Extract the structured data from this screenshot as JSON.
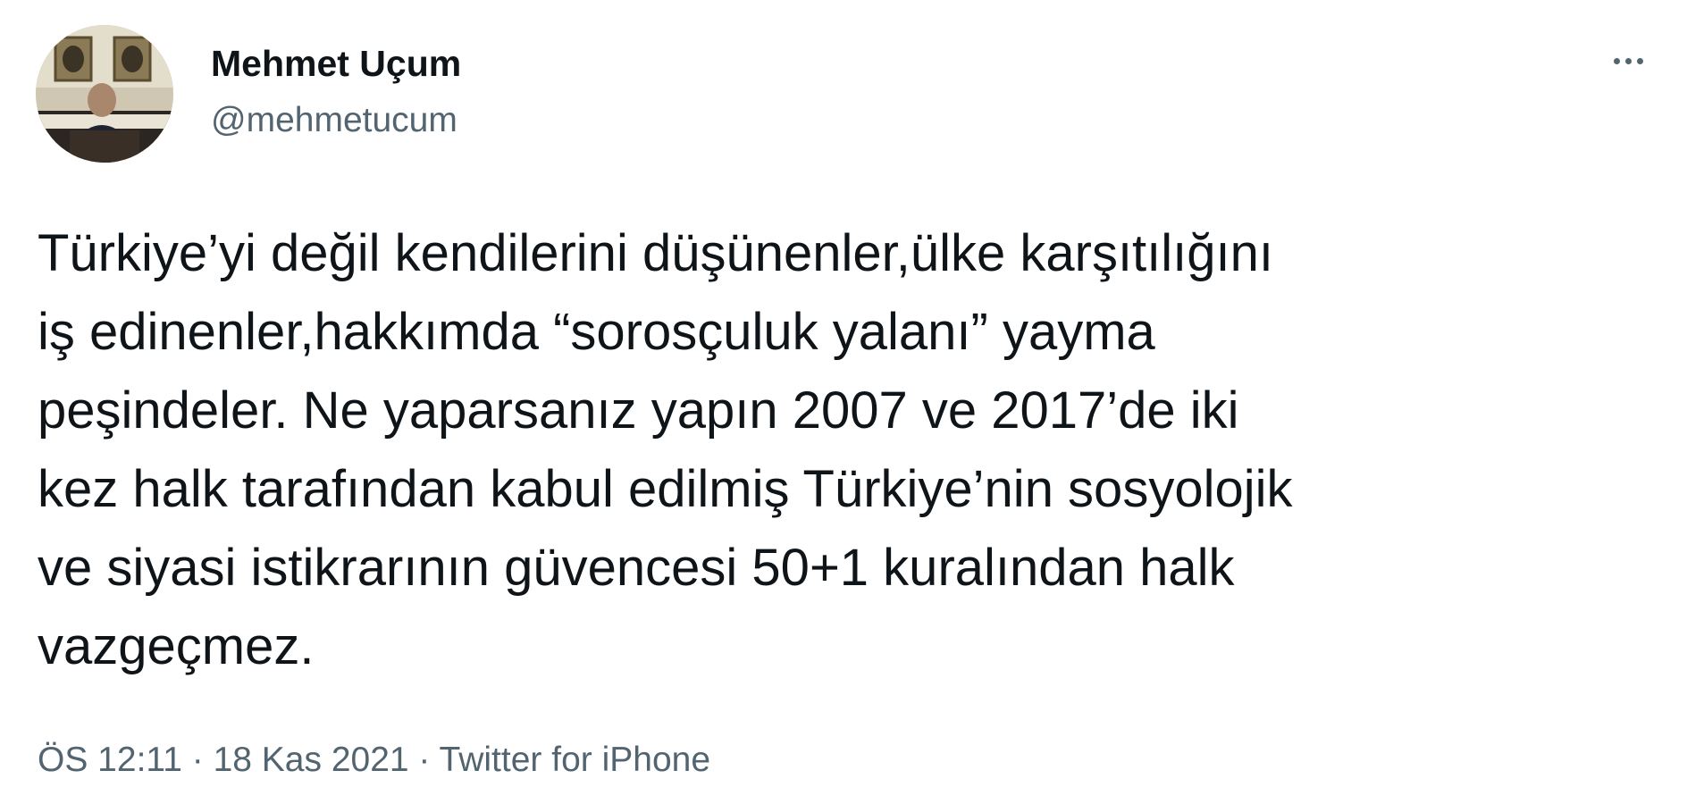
{
  "author": {
    "display_name": "Mehmet Uçum",
    "handle": "@mehmetucum",
    "avatar_icon": "profile-photo"
  },
  "more_icon": "more-horizontal-icon",
  "tweet": {
    "lines": [
      "Türkiye’yi değil kendilerini düşünenler,ülke karşıtılığını",
      "iş edinenler,hakkımda “sorosçuluk yalanı” yayma",
      "peşindeler. Ne yaparsanız yapın 2007 ve 2017’de iki",
      "kez halk tarafından kabul edilmiş Türkiye’nin sosyolojik",
      "ve siyasi istikrarının güvencesi 50+1 kuralından halk",
      "vazgeçmez."
    ]
  },
  "meta": {
    "time": "ÖS 12:11",
    "separator": " · ",
    "date": "18 Kas 2021",
    "source": "Twitter for iPhone"
  },
  "colors": {
    "text_primary": "#0f1419",
    "text_secondary": "#536471",
    "background": "#ffffff"
  }
}
